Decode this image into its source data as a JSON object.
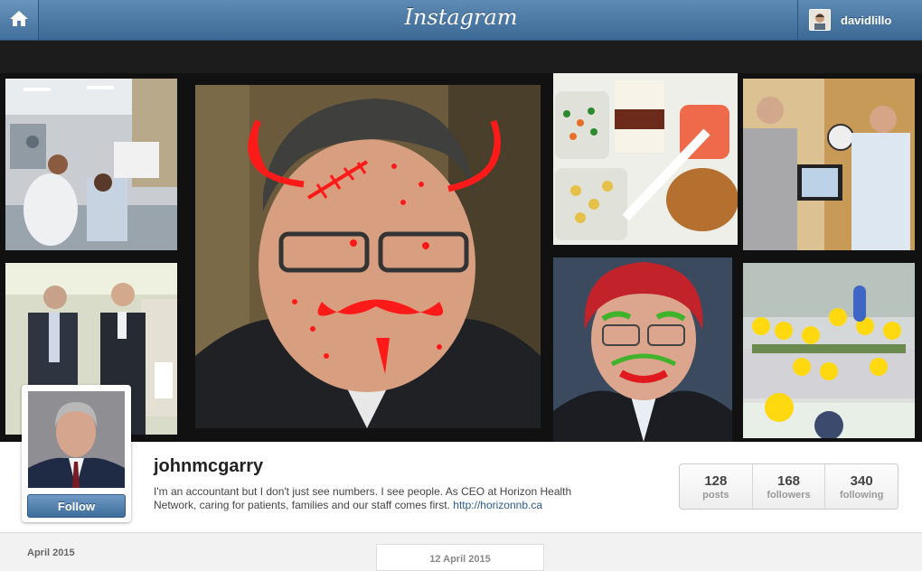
{
  "header": {
    "logo": "Instagram",
    "home_icon": "home-icon",
    "current_user": "davidlillo"
  },
  "grid": {
    "photos": [
      {
        "name": "hospital-ward-photo"
      },
      {
        "name": "two-men-hallway-photo"
      },
      {
        "name": "devil-drawing-portrait-photo"
      },
      {
        "name": "hospital-food-tray-photo"
      },
      {
        "name": "clown-drawing-portrait-photo"
      },
      {
        "name": "doctors-xray-photo"
      },
      {
        "name": "cartoon-waiting-room-photo"
      }
    ]
  },
  "profile": {
    "username": "johnmcgarry",
    "bio": "I'm an accountant but I don't just see numbers. I see people. As CEO at Horizon Health Network, caring for patients, families and our staff comes first.",
    "link": "http://horizonnb.ca",
    "follow_label": "Follow",
    "stats": [
      {
        "value": "128",
        "label": "posts"
      },
      {
        "value": "168",
        "label": "followers"
      },
      {
        "value": "340",
        "label": "following"
      }
    ]
  },
  "timeline": {
    "month": "April 2015",
    "date": "12 April 2015"
  },
  "colors": {
    "header_blue": "#3b6995",
    "link_blue": "#2a5c8e",
    "follow_blue": "#4f7fae"
  }
}
